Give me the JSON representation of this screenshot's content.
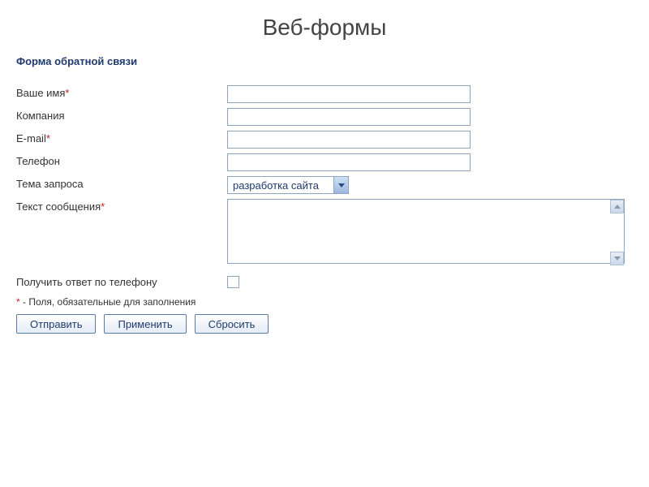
{
  "page_title": "Веб-формы",
  "form": {
    "title": "Форма обратной связи",
    "fields": {
      "name": {
        "label": "Ваше имя",
        "required": "*",
        "value": ""
      },
      "company": {
        "label": "Компания",
        "value": ""
      },
      "email": {
        "label": "E-mail",
        "required": "*",
        "value": ""
      },
      "phone": {
        "label": "Телефон",
        "value": ""
      },
      "subject": {
        "label": "Тема запроса",
        "value": "разработка сайта"
      },
      "message": {
        "label": "Текст сообщения",
        "required": "*",
        "value": ""
      },
      "answer_by_phone": {
        "label": "Получить ответ по телефону"
      }
    },
    "note_star": "*",
    "note_text": " - Поля, обязательные для заполнения",
    "buttons": {
      "submit": "Отправить",
      "apply": "Применить",
      "reset": "Сбросить"
    }
  }
}
